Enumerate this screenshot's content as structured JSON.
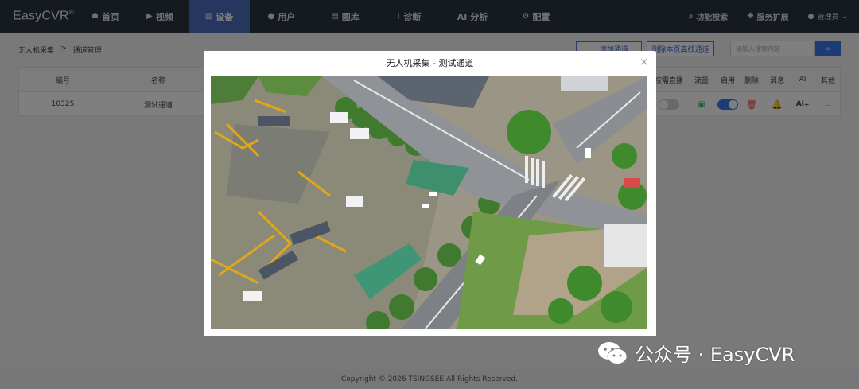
{
  "app": {
    "logo": "EasyCVR",
    "logo_mark": "®"
  },
  "nav": {
    "items": [
      {
        "label": "首页",
        "icon": "home-icon"
      },
      {
        "label": "视频",
        "icon": "play-icon"
      },
      {
        "label": "设备",
        "icon": "device-icon",
        "active": true
      },
      {
        "label": "用户",
        "icon": "user-icon"
      },
      {
        "label": "图库",
        "icon": "gallery-icon"
      },
      {
        "label": "诊断",
        "icon": "diagnosis-icon"
      },
      {
        "label": "AI 分析",
        "icon": ""
      },
      {
        "label": "配置",
        "icon": "gear-icon"
      }
    ],
    "search_label": "功能搜索",
    "extend_label": "服务扩展",
    "user_label": "管理员"
  },
  "breadcrumb": {
    "parent": "无人机采集",
    "separator": ">",
    "current": "通道管理"
  },
  "toolbar": {
    "add_label": "添加通道",
    "delete_offline_label": "删除本页离线通道",
    "search_placeholder": "请输入搜索内容"
  },
  "table": {
    "headers": {
      "id": "编号",
      "name": "名称",
      "ondemand": "按需直播",
      "traffic": "流量",
      "enable": "启用",
      "delete": "删除",
      "message": "消息",
      "ai": "AI",
      "other": "其他"
    },
    "rows": [
      {
        "id": "10325",
        "name": "测试通道",
        "ai": "AI",
        "ai_mark": "+",
        "other": "..."
      }
    ]
  },
  "modal": {
    "title": "无人机采集 - 测试通道",
    "close": "×"
  },
  "footer": {
    "text": "Copyright © 2026 TSINGSEE All Rights Reserved."
  },
  "watermark": {
    "text": "公众号 · EasyCVR"
  },
  "colors": {
    "nav_bg": "#2b3340",
    "nav_active": "#4a6fbf",
    "accent": "#3b78e7",
    "danger": "#e8463a",
    "warning": "#f0a020",
    "success": "#3db865"
  }
}
